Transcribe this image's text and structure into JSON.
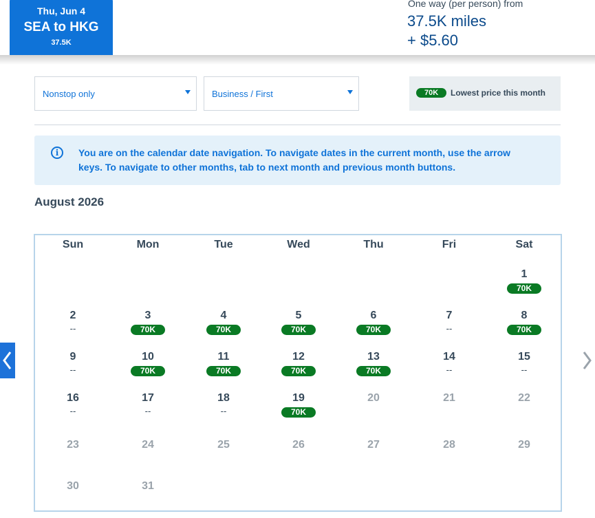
{
  "trip": {
    "date": "Thu, Jun 4",
    "route": "SEA to HKG",
    "miles": "37.5K"
  },
  "price": {
    "caption": "One way (per person) from",
    "miles": "37.5K miles",
    "fee": "+ $5.60"
  },
  "filters": {
    "stops": "Nonstop only",
    "cabin": "Business / First"
  },
  "legend": {
    "badge": "70K",
    "text": "Lowest price this month"
  },
  "info": {
    "icon": "info-icon",
    "text": "You are on the calendar date navigation. To navigate dates in the current month, use the arrow keys. To navigate to other months, tab to next month and previous month buttons."
  },
  "calendar": {
    "month": "August 2026",
    "weekdays": [
      "Sun",
      "Mon",
      "Tue",
      "Wed",
      "Thu",
      "Fri",
      "Sat"
    ],
    "days": [
      {
        "day": "1",
        "price": "70K",
        "status": "available"
      },
      {
        "day": "2",
        "price": "--",
        "status": "none"
      },
      {
        "day": "3",
        "price": "70K",
        "status": "available"
      },
      {
        "day": "4",
        "price": "70K",
        "status": "available"
      },
      {
        "day": "5",
        "price": "70K",
        "status": "available"
      },
      {
        "day": "6",
        "price": "70K",
        "status": "available"
      },
      {
        "day": "7",
        "price": "--",
        "status": "none"
      },
      {
        "day": "8",
        "price": "70K",
        "status": "available"
      },
      {
        "day": "9",
        "price": "--",
        "status": "none"
      },
      {
        "day": "10",
        "price": "70K",
        "status": "available"
      },
      {
        "day": "11",
        "price": "70K",
        "status": "available"
      },
      {
        "day": "12",
        "price": "70K",
        "status": "available"
      },
      {
        "day": "13",
        "price": "70K",
        "status": "available"
      },
      {
        "day": "14",
        "price": "--",
        "status": "none"
      },
      {
        "day": "15",
        "price": "--",
        "status": "none"
      },
      {
        "day": "16",
        "price": "--",
        "status": "none"
      },
      {
        "day": "17",
        "price": "--",
        "status": "none"
      },
      {
        "day": "18",
        "price": "--",
        "status": "none"
      },
      {
        "day": "19",
        "price": "70K",
        "status": "available"
      },
      {
        "day": "20",
        "price": "",
        "status": "inactive"
      },
      {
        "day": "21",
        "price": "",
        "status": "inactive"
      },
      {
        "day": "22",
        "price": "",
        "status": "inactive"
      },
      {
        "day": "23",
        "price": "",
        "status": "inactive"
      },
      {
        "day": "24",
        "price": "",
        "status": "inactive"
      },
      {
        "day": "25",
        "price": "",
        "status": "inactive"
      },
      {
        "day": "26",
        "price": "",
        "status": "inactive"
      },
      {
        "day": "27",
        "price": "",
        "status": "inactive"
      },
      {
        "day": "28",
        "price": "",
        "status": "inactive"
      },
      {
        "day": "29",
        "price": "",
        "status": "inactive"
      },
      {
        "day": "30",
        "price": "",
        "status": "inactive"
      },
      {
        "day": "31",
        "price": "",
        "status": "inactive"
      }
    ]
  },
  "nav": {
    "prev_icon": "chevron-left-icon",
    "next_icon": "chevron-right-icon"
  },
  "colors": {
    "brand_blue": "#0f73d8",
    "price_green": "#0a7a24",
    "info_bg": "#e4f1fa"
  }
}
